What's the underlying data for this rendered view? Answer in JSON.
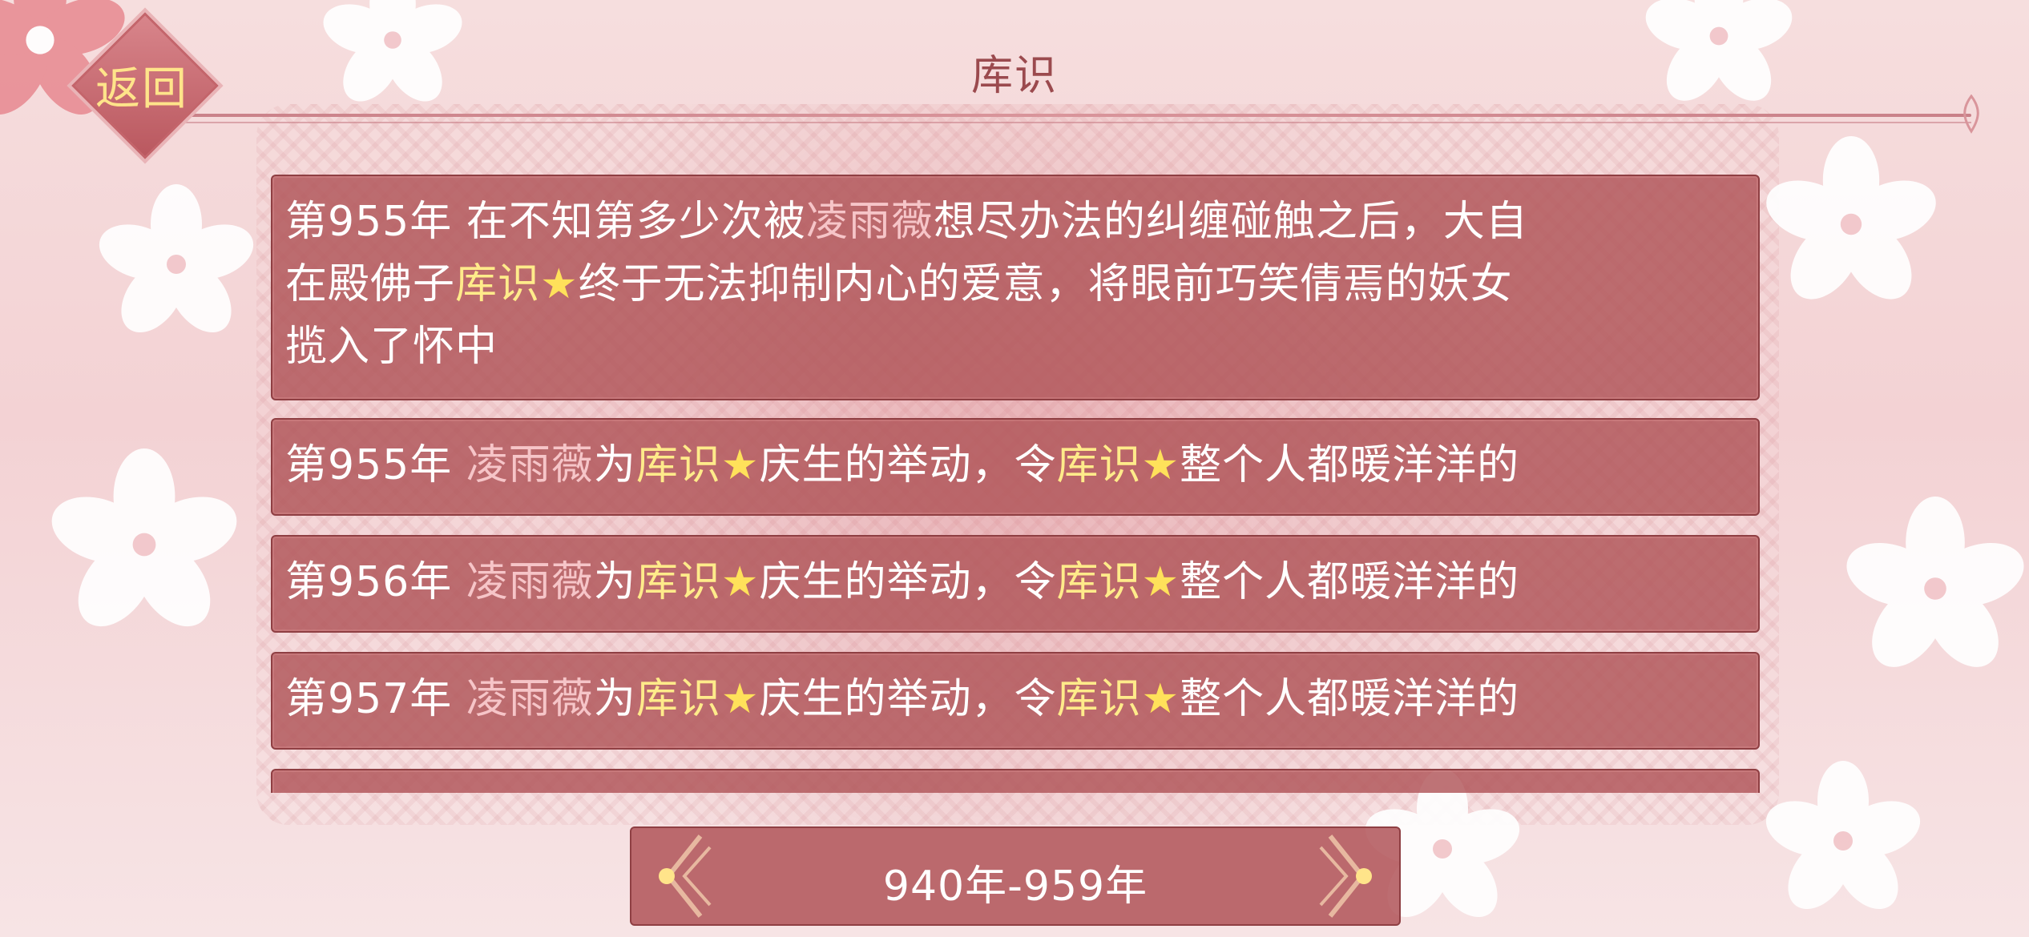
{
  "header": {
    "title": "库识",
    "back_label": "返回"
  },
  "entries": [
    {
      "year": "第955年",
      "lines": [
        [
          {
            "t": "在不知第多少次被",
            "c": "w"
          },
          {
            "t": "凌雨薇",
            "c": "p"
          },
          {
            "t": "想尽办法的纠缠碰触之后，大自",
            "c": "w"
          }
        ],
        [
          {
            "t": "在殿佛子",
            "c": "w"
          },
          {
            "t": "库识",
            "c": "y"
          },
          {
            "t": "★",
            "c": "s"
          },
          {
            "t": "终于无法抑制内心的爱意，将眼前巧笑倩焉的妖女",
            "c": "w"
          }
        ],
        [
          {
            "t": "揽入了怀中",
            "c": "w"
          }
        ]
      ]
    },
    {
      "year": "第955年",
      "lines": [
        [
          {
            "t": "凌雨薇",
            "c": "p"
          },
          {
            "t": "为",
            "c": "w"
          },
          {
            "t": "库识",
            "c": "y"
          },
          {
            "t": "★",
            "c": "s"
          },
          {
            "t": "庆生的举动，令",
            "c": "w"
          },
          {
            "t": "库识",
            "c": "y"
          },
          {
            "t": "★",
            "c": "s"
          },
          {
            "t": "整个人都暖洋洋的",
            "c": "w"
          }
        ]
      ]
    },
    {
      "year": "第956年",
      "lines": [
        [
          {
            "t": "凌雨薇",
            "c": "p"
          },
          {
            "t": "为",
            "c": "w"
          },
          {
            "t": "库识",
            "c": "y"
          },
          {
            "t": "★",
            "c": "s"
          },
          {
            "t": "庆生的举动，令",
            "c": "w"
          },
          {
            "t": "库识",
            "c": "y"
          },
          {
            "t": "★",
            "c": "s"
          },
          {
            "t": "整个人都暖洋洋的",
            "c": "w"
          }
        ]
      ]
    },
    {
      "year": "第957年",
      "lines": [
        [
          {
            "t": "凌雨薇",
            "c": "p"
          },
          {
            "t": "为",
            "c": "w"
          },
          {
            "t": "库识",
            "c": "y"
          },
          {
            "t": "★",
            "c": "s"
          },
          {
            "t": "庆生的举动，令",
            "c": "w"
          },
          {
            "t": "库识",
            "c": "y"
          },
          {
            "t": "★",
            "c": "s"
          },
          {
            "t": "整个人都暖洋洋的",
            "c": "w"
          }
        ]
      ]
    }
  ],
  "pagination": {
    "label": "940年-959年",
    "prev_icon": "chevron-left-icon",
    "next_icon": "chevron-right-icon"
  },
  "colors": {
    "panel": "#b05458",
    "highlight_name": "#f6c5c8",
    "highlight_self": "#ffeb8a",
    "star": "#ffe15a",
    "title": "#9b4a4e"
  }
}
